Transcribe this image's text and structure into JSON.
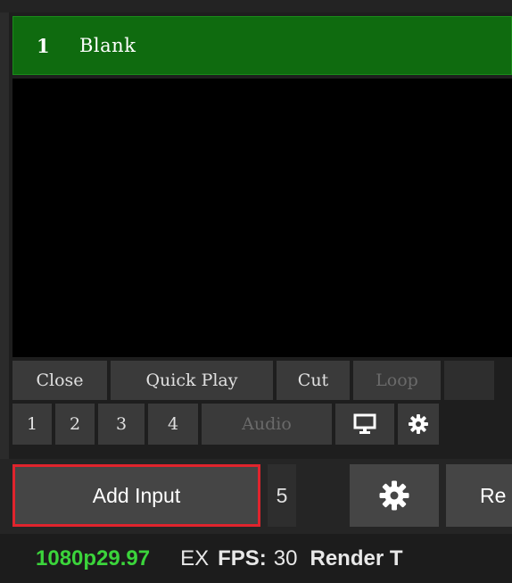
{
  "input": {
    "number": "1",
    "name": "Blank",
    "header_color": "#0f6b0f"
  },
  "controls": {
    "row1": [
      "Close",
      "Quick Play",
      "Cut",
      "Loop"
    ],
    "row2": [
      "1",
      "2",
      "3",
      "4",
      "Audio"
    ],
    "icons": [
      "monitor-icon",
      "gear-icon"
    ]
  },
  "toolbar": {
    "add_input_label": "Add Input",
    "input_count": "5",
    "re_label": "Re",
    "highlight_color": "#e0242d"
  },
  "status": {
    "format": "1080p29.97",
    "ex": "EX",
    "fps_label": "FPS:",
    "fps_value": "30",
    "render_label": "Render T"
  }
}
